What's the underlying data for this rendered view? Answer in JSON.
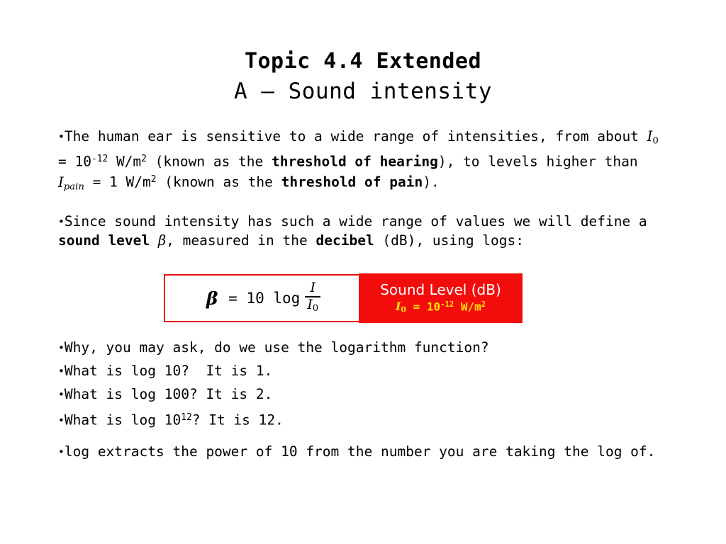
{
  "slide": {
    "title_line1": "Topic 4.4 Extended",
    "title_line2": "A – Sound intensity",
    "background_color": "#ffffff",
    "text_color": "#000000"
  },
  "bullets": {
    "bullet_glyph": "•",
    "ear": {
      "text_plain": "•The human ear is sensitive to a wide range of intensities, from about I0 = 10-12 W/m2 (known as the threshold of hearing), to levels higher than Ipain = 1 W/m2 (known as the threshold of pain).",
      "seg1": "The human ear is sensitive to a wide range of intensities, from about ",
      "var_I0": "I",
      "var_I0_sub": "0",
      "seg2": " = 10",
      "exp_minus12": "-12",
      "seg3": " W/m",
      "exp_2a": "2",
      "seg4": " (known as the ",
      "bold_threshold_hearing": "threshold of hearing",
      "seg5": "), to levels higher than ",
      "var_Ipain": "I",
      "var_Ipain_sub": "pain",
      "seg6": " = 1 W/m",
      "exp_2b": "2",
      "seg7": " (known as the ",
      "bold_threshold_pain": "threshold of pain",
      "seg8": ")."
    },
    "since": {
      "text_plain": "•Since sound intensity has such a wide range of values we will define a sound level β, measured in the decibel (dB), using logs:",
      "seg1": "Since sound intensity has such a wide range of values we will define a ",
      "bold_sound_level": "sound level",
      "beta": "β",
      "seg2": ", measured in the ",
      "bold_decibel": "decibel",
      "seg3": " (dB), using logs:"
    },
    "why": "Why, you may ask, do we use the logarithm function?",
    "log10": {
      "prefix": "What is log 10?  It is 1."
    },
    "log100": {
      "prefix": "What is log 100? It is 2."
    },
    "log1012": {
      "seg1": "What is log 10",
      "exp": "12",
      "seg2": "? It is 12."
    },
    "extracts": "log extracts the power of 10 from the number you are taking the log of."
  },
  "formula_box": {
    "border_color": "#e81313",
    "background_color": "#ffffff",
    "beta": "β",
    "equals_and_coefficient": " = 10 log",
    "fraction_numerator": "I",
    "fraction_denominator_var": "I",
    "fraction_denominator_sub": "0",
    "formula_plain": "β = 10 log I/I0"
  },
  "sound_level_box": {
    "background_color": "#f20c0c",
    "title": "Sound Level (dB)",
    "title_color": "#ffffff",
    "subtitle_color": "#ffe500",
    "sub_var": "I",
    "sub_var_sub": "0",
    "sub_seg1": " = 10",
    "sub_exp": "-12",
    "sub_seg2": " W/m",
    "sub_exp2": "2",
    "subtitle_plain": "I0 = 10-12 W/m2"
  }
}
